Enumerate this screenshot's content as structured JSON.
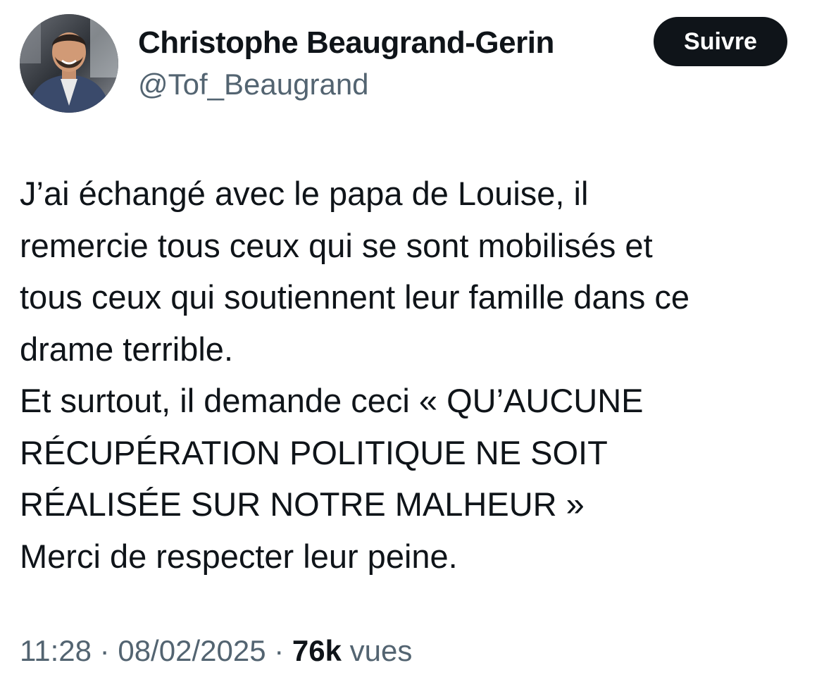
{
  "author": {
    "display_name": "Christophe Beaugrand-Gerin",
    "handle": "@Tof_Beaugrand",
    "avatar_icon": "profile-photo-avatar"
  },
  "follow_button": {
    "label": "Suivre"
  },
  "tweet": {
    "lines": [
      "J’ai échangé avec le papa de Louise, il",
      "remercie tous ceux qui se sont mobilisés et",
      "tous ceux qui soutiennent leur famille dans ce",
      "drame terrible.",
      "Et surtout, il demande ceci « QU’AUCUNE",
      "RÉCUPÉRATION POLITIQUE NE SOIT",
      "RÉALISÉE SUR NOTRE MALHEUR »",
      "Merci de respecter leur peine."
    ]
  },
  "meta": {
    "time": "11:28",
    "separator": "·",
    "date": "08/02/2025",
    "views_count": "76k",
    "views_label": "vues"
  },
  "colors": {
    "text_primary": "#0f1419",
    "text_secondary": "#536471",
    "button_bg": "#0f1419",
    "button_text": "#ffffff",
    "background": "#ffffff"
  }
}
